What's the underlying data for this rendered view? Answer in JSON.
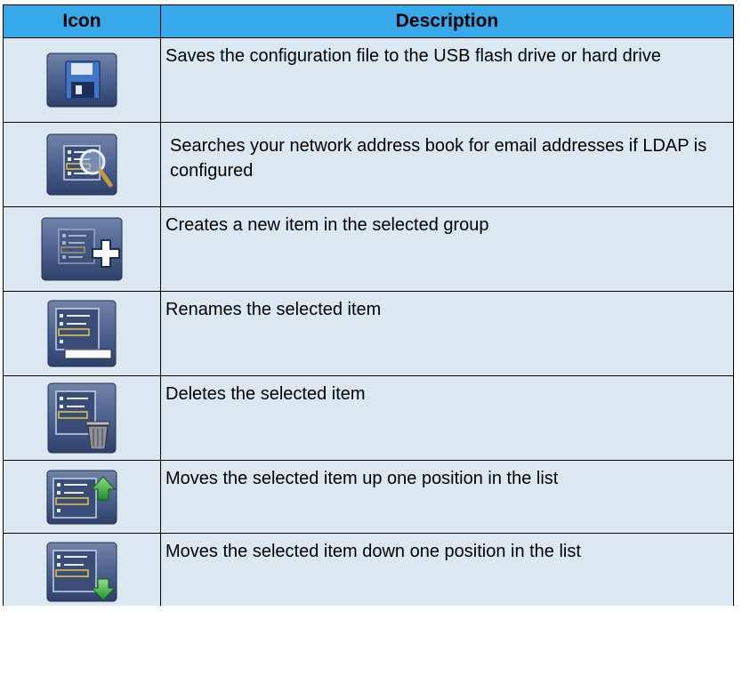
{
  "table": {
    "headers": {
      "icon": "Icon",
      "description": "Description"
    },
    "rows": [
      {
        "icon": "save-icon",
        "description": "Saves the configuration file to the USB flash drive or hard drive"
      },
      {
        "icon": "search-address-book-icon",
        "description": "Searches your network address book for email addresses if LDAP is configured"
      },
      {
        "icon": "new-item-icon",
        "description": "Creates a new item in the selected group"
      },
      {
        "icon": "rename-icon",
        "description": "Renames the selected item"
      },
      {
        "icon": "delete-icon",
        "description": "Deletes the selected item"
      },
      {
        "icon": "move-up-icon",
        "description": "Moves the selected item up one position in the list"
      },
      {
        "icon": "move-down-icon",
        "description": "Moves the selected item down one position in the list"
      }
    ]
  },
  "colors": {
    "header_bg": "#37a8ea",
    "row_bg": "#dce8f1",
    "icon_bg": "#4a5f88",
    "icon_arrow": "#3ab54a"
  }
}
